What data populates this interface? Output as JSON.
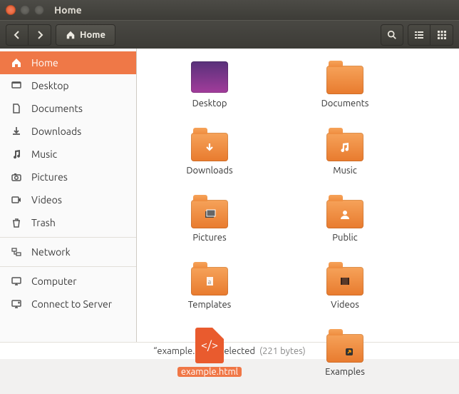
{
  "window": {
    "title": "Home"
  },
  "toolbar": {
    "path_label": "Home"
  },
  "sidebar": {
    "items": [
      {
        "label": "Home",
        "icon": "home"
      },
      {
        "label": "Desktop",
        "icon": "desktop"
      },
      {
        "label": "Documents",
        "icon": "document"
      },
      {
        "label": "Downloads",
        "icon": "download"
      },
      {
        "label": "Music",
        "icon": "music"
      },
      {
        "label": "Pictures",
        "icon": "camera"
      },
      {
        "label": "Videos",
        "icon": "video"
      },
      {
        "label": "Trash",
        "icon": "trash"
      }
    ],
    "itemsB": [
      {
        "label": "Network",
        "icon": "network"
      }
    ],
    "itemsC": [
      {
        "label": "Computer",
        "icon": "computer"
      },
      {
        "label": "Connect to Server",
        "icon": "server"
      }
    ],
    "active_index": 0
  },
  "files": [
    {
      "label": "Desktop",
      "icon": "wallpaper"
    },
    {
      "label": "Documents",
      "icon": "folder"
    },
    {
      "label": "Downloads",
      "icon": "folder-download"
    },
    {
      "label": "Music",
      "icon": "folder-music"
    },
    {
      "label": "Pictures",
      "icon": "folder-pictures"
    },
    {
      "label": "Public",
      "icon": "folder-public"
    },
    {
      "label": "Templates",
      "icon": "folder-templates"
    },
    {
      "label": "Videos",
      "icon": "folder-videos"
    },
    {
      "label": "example.html",
      "icon": "htmlfile",
      "selected": true
    },
    {
      "label": "Examples",
      "icon": "folder-link"
    }
  ],
  "status": {
    "text": "“example.html” selected",
    "meta": "(221 bytes)"
  }
}
